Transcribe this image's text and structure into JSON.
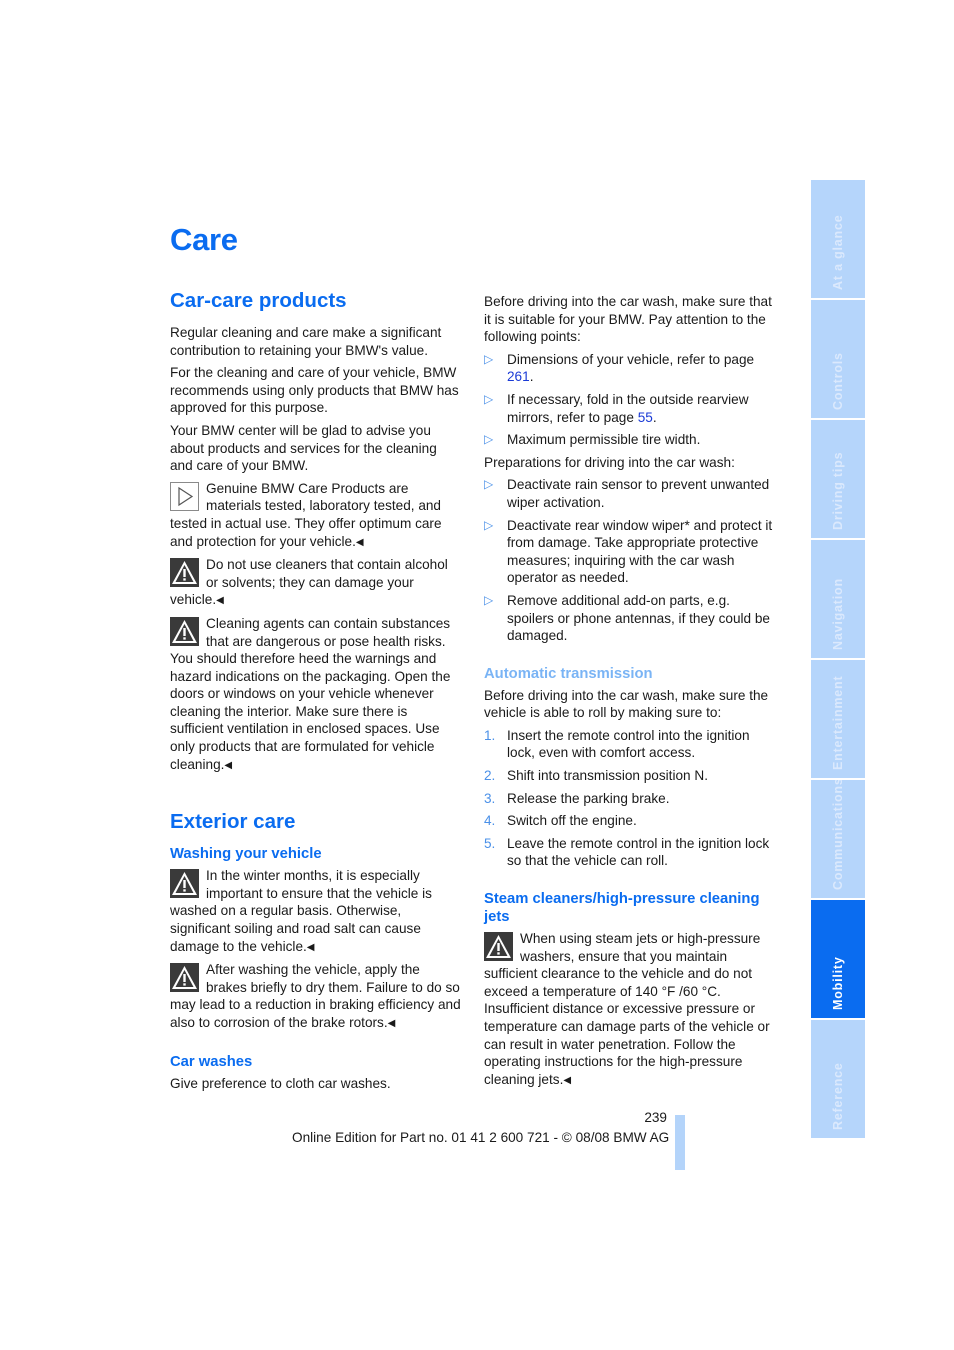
{
  "page": {
    "title": "Care",
    "page_number": "239",
    "footer": "Online Edition for Part no. 01 41 2 600 721 - © 08/08 BMW AG"
  },
  "side_tabs": [
    {
      "label": "At a glance",
      "active": false
    },
    {
      "label": "Controls",
      "active": false
    },
    {
      "label": "Driving tips",
      "active": false
    },
    {
      "label": "Navigation",
      "active": false
    },
    {
      "label": "Entertainment",
      "active": false
    },
    {
      "label": "Communications",
      "active": false
    },
    {
      "label": "Mobility",
      "active": true
    },
    {
      "label": "Reference",
      "active": false
    }
  ],
  "car_care": {
    "heading": "Car-care products",
    "p1": "Regular cleaning and care make a significant contribution to retaining your BMW's value.",
    "p2": "For the cleaning and care of your vehicle, BMW recommends using only products that BMW has approved for this purpose.",
    "p3": "Your BMW center will be glad to advise you about products and services for the cleaning and care of your BMW.",
    "tip": "Genuine BMW Care Products are materials tested, laboratory tested, and tested in actual use. They offer optimum care and protection for your vehicle.",
    "warn1": "Do not use cleaners that contain alcohol or solvents; they can damage your vehicle.",
    "warn2": "Cleaning agents can contain substances that are dangerous or pose health risks. You should therefore heed the warnings and hazard indications on the packaging. Open the doors or windows on your vehicle whenever cleaning the interior. Make sure there is sufficient ventilation in enclosed spaces. Use only products that are formulated for vehicle cleaning."
  },
  "exterior": {
    "heading": "Exterior care",
    "washing_heading": "Washing your vehicle",
    "warn1": "In the winter months, it is especially important to ensure that the vehicle is washed on a regular basis. Otherwise, significant soiling and road salt can cause damage to the vehicle.",
    "warn2": "After washing the vehicle, apply the brakes briefly to dry them. Failure to do so may lead to a reduction in braking efficiency and also to corrosion of the brake rotors.",
    "car_washes_heading": "Car washes",
    "car_washes_text": "Give preference to cloth car washes."
  },
  "right": {
    "intro": "Before driving into the car wash, make sure that it is suitable for your BMW. Pay attention to the following points:",
    "points": [
      {
        "text": "Dimensions of your vehicle, refer to page ",
        "link": "261",
        "after": "."
      },
      {
        "text": "If necessary, fold in the outside rearview mirrors, refer to page ",
        "link": "55",
        "after": "."
      },
      {
        "text": "Maximum permissible tire width.",
        "link": null,
        "after": ""
      }
    ],
    "prep_intro": "Preparations for driving into the car wash:",
    "prep": [
      "Deactivate rain sensor to prevent unwanted wiper activation.",
      "Deactivate rear window wiper* and protect it from damage. Take appropriate protective measures; inquiring with the car wash operator as needed.",
      "Remove additional add-on parts, e.g. spoilers or phone antennas, if they could be damaged."
    ],
    "auto_heading": "Automatic transmission",
    "auto_intro": "Before driving into the car wash, make sure the vehicle is able to roll by making sure to:",
    "steps": [
      {
        "num": "1.",
        "text": "Insert the remote control into the ignition lock, even with comfort access."
      },
      {
        "num": "2.",
        "text": "Shift into transmission position N."
      },
      {
        "num": "3.",
        "text": "Release the parking brake."
      },
      {
        "num": "4.",
        "text": "Switch off the engine."
      },
      {
        "num": "5.",
        "text": "Leave the remote control in the ignition lock so that the vehicle can roll."
      }
    ],
    "steam_heading": "Steam cleaners/high-pressure cleaning jets",
    "steam_warn": "When using steam jets or high-pressure washers, ensure that you maintain sufficient clearance to the vehicle and do not exceed a temperature of 140 °F /60 °C.",
    "steam_warn2": "Insufficient distance or excessive pressure or temperature can damage parts of the vehicle or can result in water penetration. Follow the operating instructions for the high-pressure cleaning jets."
  },
  "icons": {
    "end_mark": "◀",
    "bullet": "▷"
  },
  "colors": {
    "heading_blue": "#0a6cf0",
    "subheading_light_blue": "#7ab4f5",
    "link_blue": "#1a3ad6",
    "tab_inactive": "#b5d5fb",
    "tab_active": "#0a6cf0"
  }
}
